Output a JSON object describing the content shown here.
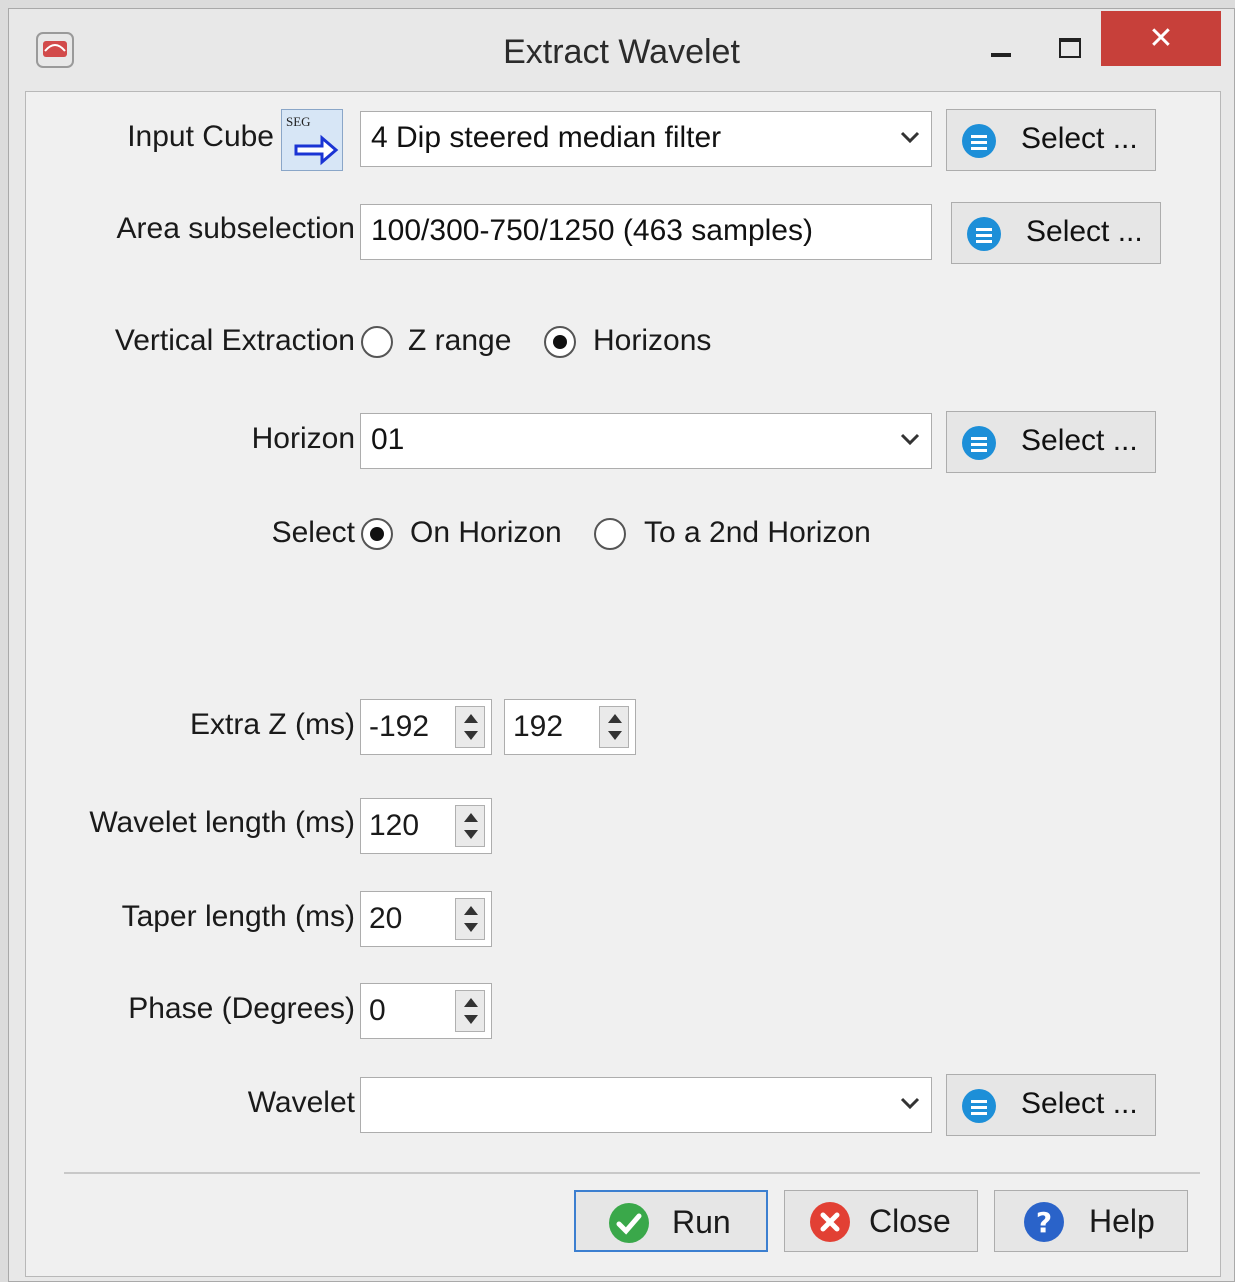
{
  "window": {
    "title": "Extract Wavelet",
    "close_glyph": "✕"
  },
  "input_cube": {
    "label": "Input Cube",
    "icon_text": "SEG",
    "value": "4 Dip steered median filter",
    "select_label": "Select ..."
  },
  "area": {
    "label": "Area subselection",
    "value": "100/300-750/1250 (463 samples)",
    "select_label": "Select ..."
  },
  "vertical": {
    "label": "Vertical Extraction",
    "option1": "Z range",
    "option2": "Horizons",
    "selected": "Horizons"
  },
  "horizon": {
    "label": "Horizon",
    "value": "01",
    "select_label": "Select ..."
  },
  "horizon_select": {
    "label": "Select",
    "option1": "On Horizon",
    "option2": "To a 2nd Horizon",
    "selected": "On Horizon"
  },
  "extra_z": {
    "label": "Extra Z (ms)",
    "from": "-192",
    "to": "192"
  },
  "wavelet_length": {
    "label": "Wavelet length (ms)",
    "value": "120"
  },
  "taper_length": {
    "label": "Taper length (ms)",
    "value": "20"
  },
  "phase": {
    "label": "Phase (Degrees)",
    "value": "0"
  },
  "wavelet": {
    "label": "Wavelet",
    "value": "",
    "select_label": "Select ..."
  },
  "buttons": {
    "run": "Run",
    "close": "Close",
    "help": "Help"
  },
  "icons": {
    "app": "seismic-app-icon",
    "select": "list-icon",
    "run": "checkmark-icon",
    "close": "cancel-icon",
    "help": "question-icon"
  }
}
